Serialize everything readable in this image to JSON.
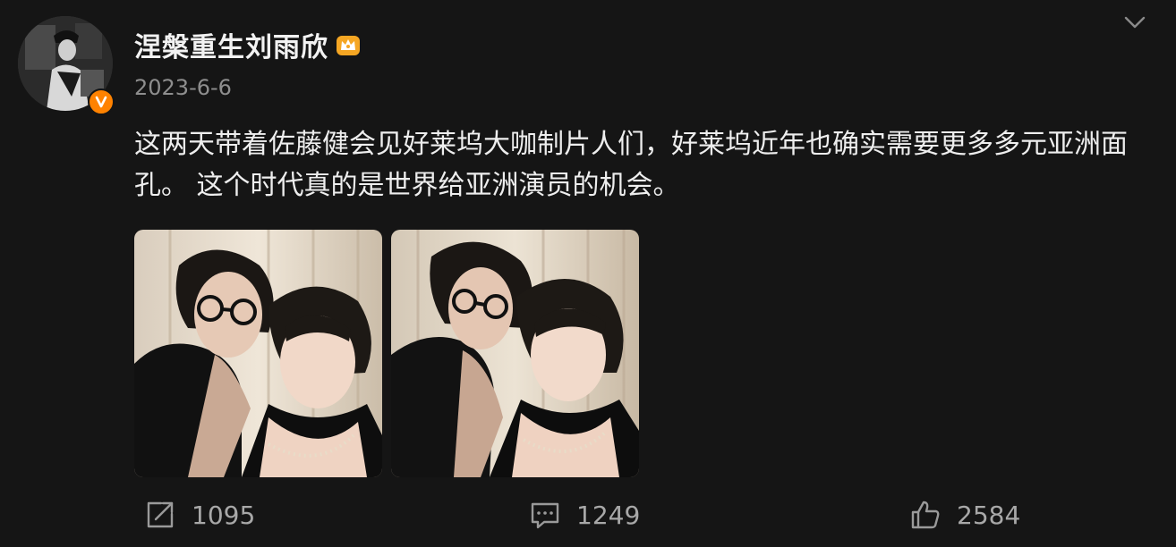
{
  "post": {
    "author": {
      "name": "涅槃重生刘雨欣",
      "avatar_icon": "user-avatar",
      "verified_icon": "verified-v-icon",
      "badge_icon": "crown-icon"
    },
    "date": "2023-6-6",
    "text": "这两天带着佐藤健会见好莱坞大咖制片人们，好莱坞近年也确实需要更多多元亚洲面孔。 这个时代真的是世界给亚洲演员的机会。",
    "images": [
      {
        "name": "post-photo-1"
      },
      {
        "name": "post-photo-2"
      }
    ],
    "menu_icon": "chevron-down-icon"
  },
  "actions": {
    "repost": {
      "icon": "share-icon",
      "count": "1095"
    },
    "comment": {
      "icon": "comment-icon",
      "count": "1249"
    },
    "like": {
      "icon": "thumbs-up-icon",
      "count": "2584"
    }
  },
  "colors": {
    "background": "#151515",
    "text": "#eeeeee",
    "muted": "#8e8e8e",
    "verified": "#ff8200",
    "crown": "#f5a623"
  }
}
